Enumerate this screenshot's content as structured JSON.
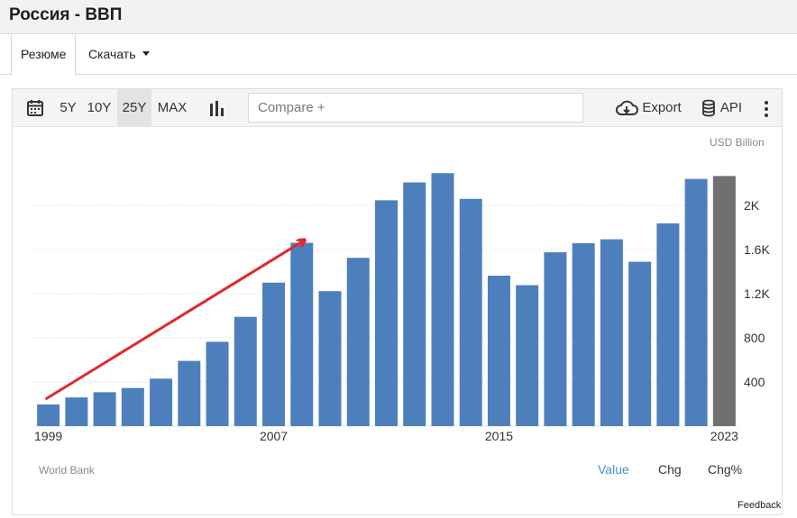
{
  "page": {
    "title": "Россия - ВВП"
  },
  "tabs": [
    {
      "label": "Резюме"
    },
    {
      "label": "Скачать"
    }
  ],
  "toolbar": {
    "ranges": [
      "5Y",
      "10Y",
      "25Y",
      "MAX"
    ],
    "selected_range": "25Y",
    "compare_placeholder": "Compare +",
    "export_label": "Export",
    "api_label": "API"
  },
  "chart": {
    "unit": "USD Billion",
    "source": "World Bank",
    "modes": [
      "Value",
      "Chg",
      "Chg%"
    ],
    "selected_mode": "Value"
  },
  "chart_data": {
    "type": "bar",
    "categories": [
      "1999",
      "2000",
      "2001",
      "2002",
      "2003",
      "2004",
      "2005",
      "2006",
      "2007",
      "2008",
      "2009",
      "2010",
      "2011",
      "2012",
      "2013",
      "2014",
      "2015",
      "2016",
      "2017",
      "2018",
      "2019",
      "2020",
      "2021",
      "2022",
      "2023"
    ],
    "values": [
      196,
      260,
      307,
      345,
      430,
      591,
      764,
      990,
      1300,
      1661,
      1223,
      1525,
      2046,
      2208,
      2292,
      2059,
      1363,
      1277,
      1575,
      1657,
      1693,
      1489,
      1837,
      2240,
      2266
    ],
    "highlighted_category": "2023",
    "x_tick_labels": [
      "1999",
      "2007",
      "2015",
      "2023"
    ],
    "y_tick_labels": [
      "400",
      "800",
      "1.2K",
      "1.6K",
      "2K"
    ],
    "ylim": [
      0,
      2400
    ],
    "colors": {
      "bar": "#4d7fbc",
      "highlight": "#707070",
      "arrow": "#e02a2a"
    },
    "annotation": {
      "type": "arrow",
      "from": {
        "category": "1999",
        "value": 250
      },
      "to": {
        "category": "2008",
        "value": 1680
      }
    }
  },
  "footer": {
    "feedback_label": "Feedback"
  }
}
